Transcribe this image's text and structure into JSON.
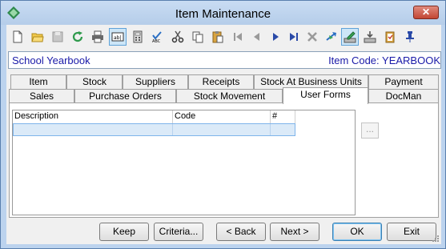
{
  "window": {
    "title": "Item Maintenance",
    "close_label": "✕"
  },
  "toolbar": {
    "buttons": [
      {
        "icon": "new-document-icon",
        "pressed": false
      },
      {
        "icon": "open-folder-icon",
        "pressed": false
      },
      {
        "icon": "save-icon",
        "pressed": false
      },
      {
        "icon": "refresh-icon",
        "pressed": false
      },
      {
        "icon": "print-icon",
        "pressed": false
      },
      {
        "icon": "text-field-icon",
        "pressed": true
      },
      {
        "icon": "calculator-icon",
        "pressed": false
      },
      {
        "icon": "spell-check-icon",
        "pressed": false
      },
      {
        "icon": "cut-icon",
        "pressed": false
      },
      {
        "icon": "copy-icon",
        "pressed": false
      },
      {
        "icon": "paste-icon",
        "pressed": false
      },
      {
        "icon": "first-record-icon",
        "pressed": false
      },
      {
        "icon": "previous-record-icon",
        "pressed": false
      },
      {
        "icon": "next-record-icon",
        "pressed": false
      },
      {
        "icon": "last-record-icon",
        "pressed": false
      },
      {
        "icon": "delete-icon",
        "pressed": false
      },
      {
        "icon": "flag-arrow-icon",
        "pressed": false
      },
      {
        "icon": "edit-tray-icon",
        "pressed": true
      },
      {
        "icon": "download-tray-icon",
        "pressed": false
      },
      {
        "icon": "clipboard-check-icon",
        "pressed": false
      },
      {
        "icon": "pin-icon",
        "pressed": false
      }
    ]
  },
  "info": {
    "item_name": "School Yearbook",
    "item_code": "Item Code: YEARBOOK"
  },
  "tabs": {
    "row1": [
      "Item",
      "Stock",
      "Suppliers",
      "Receipts",
      "Stock At Business Units",
      "Payment"
    ],
    "row2": [
      "Sales",
      "Purchase Orders",
      "Stock Movement",
      "User Forms",
      "DocMan"
    ],
    "active": "User Forms"
  },
  "grid": {
    "columns": [
      "Description",
      "Code",
      "#"
    ],
    "rows": [
      [
        "",
        "",
        ""
      ]
    ]
  },
  "side": {
    "ellipsis_label": "..."
  },
  "buttons": {
    "keep": "Keep",
    "criteria": "Criteria...",
    "back": "< Back",
    "next": "Next >",
    "ok": "OK",
    "exit": "Exit"
  },
  "colors": {
    "accent_text": "#1a1aa8",
    "selected_row": "#dbeaf8",
    "title_bar": "#bcd3ee"
  }
}
